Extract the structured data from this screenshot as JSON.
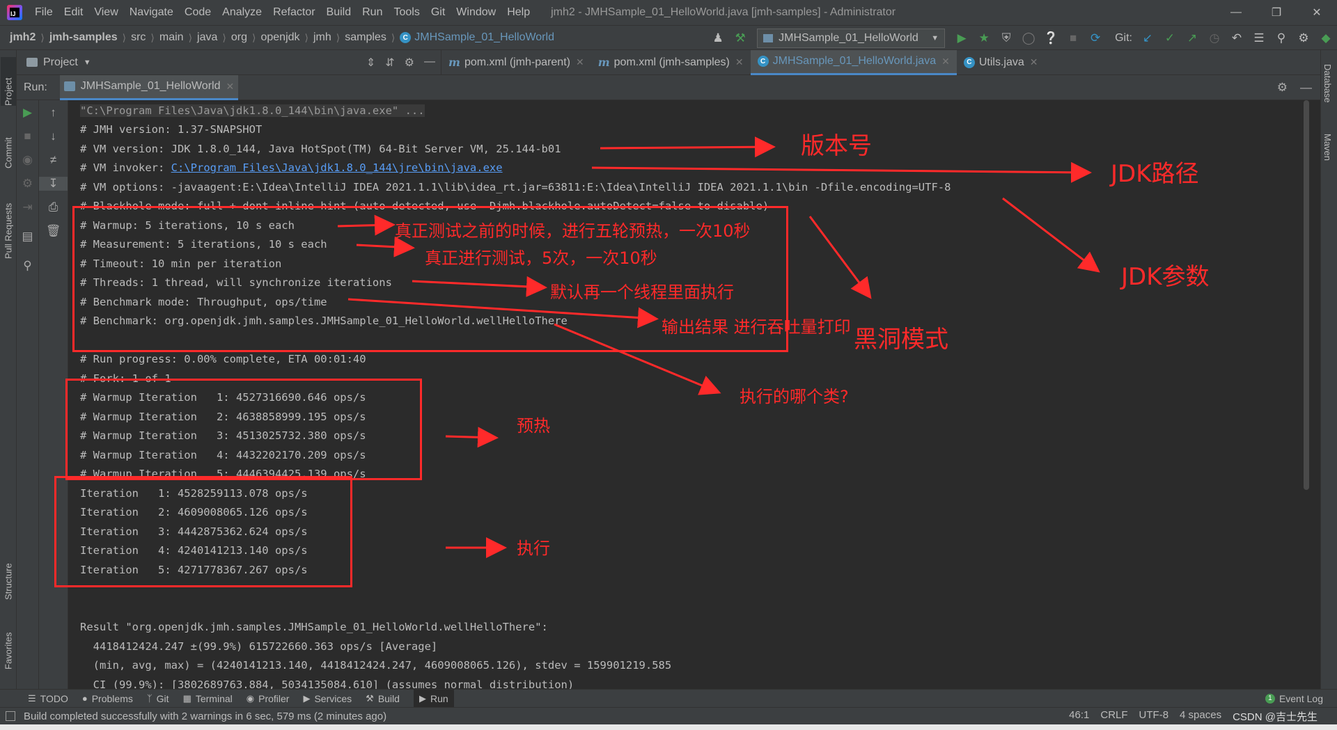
{
  "app": {
    "menu": [
      "File",
      "Edit",
      "View",
      "Navigate",
      "Code",
      "Analyze",
      "Refactor",
      "Build",
      "Run",
      "Tools",
      "Git",
      "Window",
      "Help"
    ],
    "title": "jmh2 - JMHSample_01_HelloWorld.java [jmh-samples] - Administrator",
    "icon_letters": "IJ"
  },
  "breadcrumbs": [
    "jmh2",
    "jmh-samples",
    "src",
    "main",
    "java",
    "org",
    "openjdk",
    "jmh",
    "samples",
    "JMHSample_01_HelloWorld"
  ],
  "toolbar": {
    "run_config": "JMHSample_01_HelloWorld",
    "git_label": "Git:"
  },
  "project_panel": {
    "label": "Project"
  },
  "editor_tabs": [
    {
      "label": "pom.xml (jmh-parent)",
      "icon": "m"
    },
    {
      "label": "pom.xml (jmh-samples)",
      "icon": "m"
    },
    {
      "label": "JMHSample_01_HelloWorld.java",
      "icon": "C"
    },
    {
      "label": "Utils.java",
      "icon": "C"
    }
  ],
  "left_strip": [
    "Project",
    "Commit",
    "Pull Requests",
    "Structure",
    "Favorites"
  ],
  "right_strip": [
    "Database",
    "Maven"
  ],
  "run_panel": {
    "label": "Run:",
    "tab": "JMHSample_01_HelloWorld"
  },
  "console": {
    "cmd": "\"C:\\Program Files\\Java\\jdk1.8.0_144\\bin\\java.exe\" ...",
    "jmh_version": "# JMH version: 1.37-SNAPSHOT",
    "vm_version": "# VM version: JDK 1.8.0_144, Java HotSpot(TM) 64-Bit Server VM, 25.144-b01",
    "vm_invoker_prefix": "# VM invoker: ",
    "vm_invoker_path": "C:\\Program Files\\Java\\jdk1.8.0_144\\jre\\bin\\java.exe",
    "vm_options": "# VM options: -javaagent:E:\\Idea\\IntelliJ IDEA 2021.1.1\\lib\\idea_rt.jar=63811:E:\\Idea\\IntelliJ IDEA 2021.1.1\\bin -Dfile.encoding=UTF-8",
    "blackhole": "# Blackhole mode: full + dont-inline hint (auto-detected, use -Djmh.blackhole.autoDetect=false to disable)",
    "warmup": "# Warmup: 5 iterations, 10 s each",
    "measurement": "# Measurement: 5 iterations, 10 s each",
    "timeout": "# Timeout: 10 min per iteration",
    "threads": "# Threads: 1 thread, will synchronize iterations",
    "bench_mode": "# Benchmark mode: Throughput, ops/time",
    "benchmark": "# Benchmark: org.openjdk.jmh.samples.JMHSample_01_HelloWorld.wellHelloThere",
    "run_progress": "# Run progress: 0.00% complete, ETA 00:01:40",
    "fork": "# Fork: 1 of 1",
    "warmup_iterations": [
      "# Warmup Iteration   1: 4527316690.646 ops/s",
      "# Warmup Iteration   2: 4638858999.195 ops/s",
      "# Warmup Iteration   3: 4513025732.380 ops/s",
      "# Warmup Iteration   4: 4432202170.209 ops/s",
      "# Warmup Iteration   5: 4446394425.139 ops/s"
    ],
    "iterations": [
      "Iteration   1: 4528259113.078 ops/s",
      "Iteration   2: 4609008065.126 ops/s",
      "Iteration   3: 4442875362.624 ops/s",
      "Iteration   4: 4240141213.140 ops/s",
      "Iteration   5: 4271778367.267 ops/s"
    ],
    "result": "Result \"org.openjdk.jmh.samples.JMHSample_01_HelloWorld.wellHelloThere\":",
    "result_avg": "  4418412424.247 ±(99.9%) 615722660.363 ops/s [Average]",
    "result_stats": "  (min, avg, max) = (4240141213.140, 4418412424.247, 4609008065.126), stdev = 159901219.585",
    "result_ci": "  CI (99.9%): [3802689763.884, 5034135084.610] (assumes normal distribution)"
  },
  "annotations": {
    "version": "版本号",
    "jdk_path": "JDK路径",
    "jdk_params": "JDK参数",
    "warmup": "真正测试之前的时候，进行五轮预热，一次10秒",
    "measurement": "真正进行测试，5次，一次10秒",
    "threads": "默认再一个线程里面执行",
    "output": "输出结果 进行吞吐量打印",
    "blackhole": "黑洞模式",
    "which_class": "执行的哪个类?",
    "preheat": "预热",
    "execute": "执行"
  },
  "bottom_tabs": [
    "TODO",
    "Problems",
    "Git",
    "Terminal",
    "Profiler",
    "Services",
    "Build",
    "Run"
  ],
  "event_log": {
    "label": "Event Log",
    "count": "1"
  },
  "status": {
    "message": "Build completed successfully with 2 warnings in 6 sec, 579 ms (2 minutes ago)",
    "position": "46:1",
    "line_sep": "CRLF",
    "encoding": "UTF-8",
    "indent": "4 spaces",
    "watermark": "CSDN @吉士先生"
  },
  "colors": {
    "background": "#2b2b2b",
    "panel": "#3c3f41",
    "annotation": "#ff2a2a",
    "link": "#589df6",
    "run_green": "#499c54"
  }
}
